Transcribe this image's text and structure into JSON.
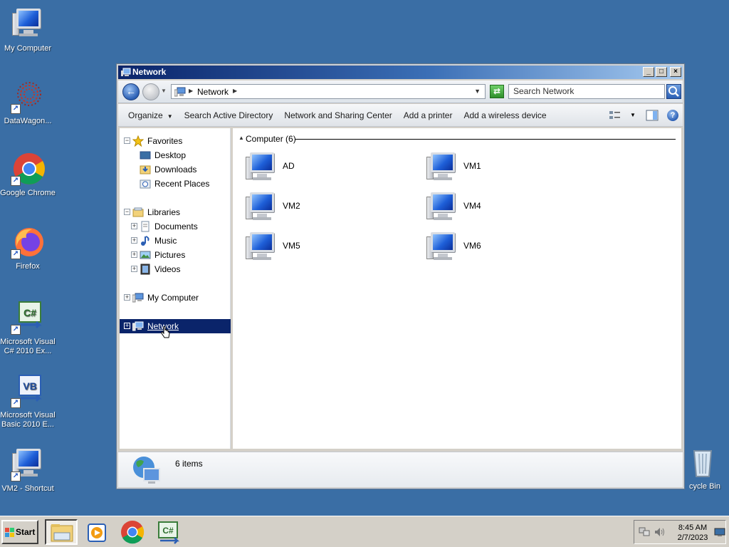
{
  "desktop": {
    "icons": [
      {
        "label": "My Computer",
        "icon": "monitor-icon"
      },
      {
        "label": "DataWagon...",
        "icon": "datawagon-icon"
      },
      {
        "label": "Google Chrome",
        "icon": "chrome-icon"
      },
      {
        "label": "Firefox",
        "icon": "firefox-icon"
      },
      {
        "label": "Microsoft Visual C# 2010 Ex...",
        "icon": "visual-csharp-icon"
      },
      {
        "label": "Microsoft Visual Basic 2010 E...",
        "icon": "visual-basic-icon"
      },
      {
        "label": "VM2 - Shortcut",
        "icon": "monitor-icon"
      },
      {
        "label": "cycle Bin",
        "icon": "recycle-bin-icon"
      }
    ]
  },
  "window": {
    "title": "Network",
    "buttons": {
      "minimize": "_",
      "maximize": "□",
      "close": "×"
    }
  },
  "addressbar": {
    "crumb": "Network",
    "search_placeholder": "Search Network"
  },
  "toolbar": {
    "organize": "Organize",
    "search_ad": "Search Active Directory",
    "network_sharing": "Network and Sharing Center",
    "add_printer": "Add a printer",
    "add_wireless": "Add a wireless device"
  },
  "navpane": {
    "favorites": "Favorites",
    "desktop": "Desktop",
    "downloads": "Downloads",
    "recent_places": "Recent Places",
    "libraries": "Libraries",
    "documents": "Documents",
    "music": "Music",
    "pictures": "Pictures",
    "videos": "Videos",
    "my_computer": "My Computer",
    "network": "Network"
  },
  "content": {
    "group_header": "Computer (6)",
    "items": [
      "AD",
      "VM1",
      "VM2",
      "VM4",
      "VM5",
      "VM6"
    ]
  },
  "details": {
    "count": "6 items"
  },
  "taskbar": {
    "start": "Start",
    "apps": [
      "windows-explorer-icon",
      "media-player-icon",
      "chrome-icon",
      "visual-csharp-icon"
    ],
    "time": "8:45 AM",
    "date": "2/7/2023"
  },
  "colors": {
    "desktop_bg": "#3a6ea5",
    "title_start": "#0a246a",
    "selection": "#0a246a",
    "chrome_face": "#d4d0c8"
  }
}
